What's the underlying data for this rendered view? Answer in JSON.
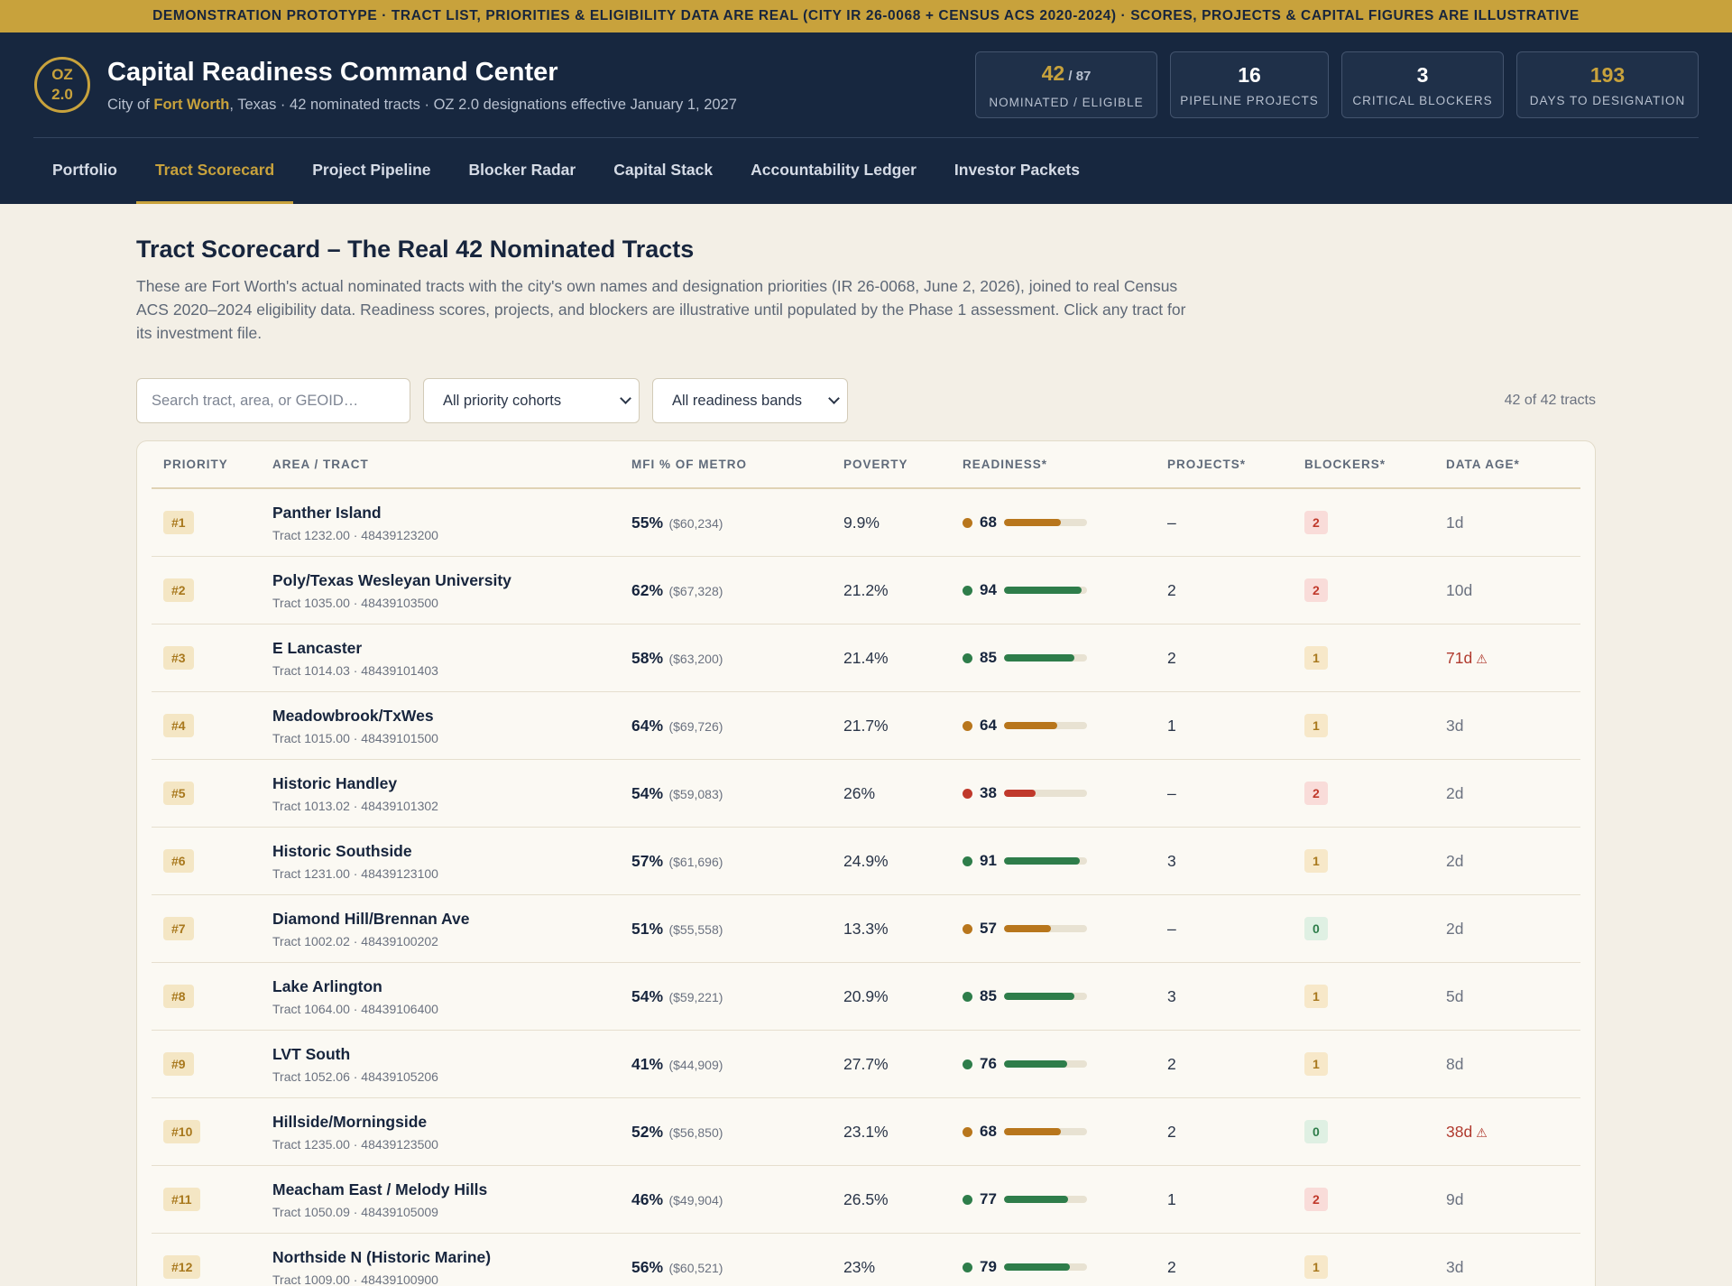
{
  "banner": "DEMONSTRATION PROTOTYPE · TRACT LIST, PRIORITIES & ELIGIBILITY DATA ARE REAL (CITY IR 26-0068 + CENSUS ACS 2020-2024) · SCORES, PROJECTS & CAPITAL FIGURES ARE ILLUSTRATIVE",
  "logo": {
    "line1": "OZ",
    "line2": "2.0"
  },
  "app": {
    "title": "Capital Readiness Command Center",
    "subtitle_pre": "City of ",
    "city": "Fort Worth",
    "subtitle_post": ", Texas · 42 nominated tracts · OZ 2.0 designations effective January 1, 2027"
  },
  "stats": [
    {
      "value": "42",
      "suffix": " / 87",
      "label": "NOMINATED / ELIGIBLE"
    },
    {
      "value": "16",
      "label": "PIPELINE PROJECTS"
    },
    {
      "value": "3",
      "label": "CRITICAL BLOCKERS"
    },
    {
      "value": "193",
      "label": "DAYS TO DESIGNATION"
    }
  ],
  "tabs": [
    "Portfolio",
    "Tract Scorecard",
    "Project Pipeline",
    "Blocker Radar",
    "Capital Stack",
    "Accountability Ledger",
    "Investor Packets"
  ],
  "page": {
    "title": "Tract Scorecard – The Real 42 Nominated Tracts",
    "description": "These are Fort Worth's actual nominated tracts with the city's own names and designation priorities (IR 26-0068, June 2, 2026), joined to real Census ACS 2020–2024 eligibility data. Readiness scores, projects, and blockers are illustrative until populated by the Phase 1 assessment. Click any tract for its investment file."
  },
  "filters": {
    "search_placeholder": "Search tract, area, or GEOID…",
    "cohort": "All priority cohorts",
    "band": "All readiness bands",
    "count": "42 of 42 tracts"
  },
  "columns": [
    "PRIORITY",
    "AREA / TRACT",
    "MFI % OF METRO",
    "POVERTY",
    "READINESS*",
    "PROJECTS*",
    "BLOCKERS*",
    "DATA AGE*"
  ],
  "colors": {
    "green": "#2e7d4a",
    "amber": "#b8761c",
    "red": "#c0392b",
    "gold": "#c8a23c",
    "navy": "#17273f"
  },
  "rows": [
    {
      "rank": "#1",
      "name": "Panther Island",
      "tract": "Tract 1232.00 · 48439123200",
      "mfi": "55%",
      "mfi_d": "($60,234)",
      "poverty": "9.9%",
      "readiness": 68,
      "band": "amber",
      "projects": "–",
      "blockers": "2",
      "blk": "r",
      "age": "1d",
      "warn": false
    },
    {
      "rank": "#2",
      "name": "Poly/Texas Wesleyan University",
      "tract": "Tract 1035.00 · 48439103500",
      "mfi": "62%",
      "mfi_d": "($67,328)",
      "poverty": "21.2%",
      "readiness": 94,
      "band": "green",
      "projects": "2",
      "blockers": "2",
      "blk": "r",
      "age": "10d",
      "warn": false
    },
    {
      "rank": "#3",
      "name": "E Lancaster",
      "tract": "Tract 1014.03 · 48439101403",
      "mfi": "58%",
      "mfi_d": "($63,200)",
      "poverty": "21.4%",
      "readiness": 85,
      "band": "green",
      "projects": "2",
      "blockers": "1",
      "blk": "a",
      "age": "71d",
      "warn": true
    },
    {
      "rank": "#4",
      "name": "Meadowbrook/TxWes",
      "tract": "Tract 1015.00 · 48439101500",
      "mfi": "64%",
      "mfi_d": "($69,726)",
      "poverty": "21.7%",
      "readiness": 64,
      "band": "amber",
      "projects": "1",
      "blockers": "1",
      "blk": "a",
      "age": "3d",
      "warn": false
    },
    {
      "rank": "#5",
      "name": "Historic Handley",
      "tract": "Tract 1013.02 · 48439101302",
      "mfi": "54%",
      "mfi_d": "($59,083)",
      "poverty": "26%",
      "readiness": 38,
      "band": "red",
      "projects": "–",
      "blockers": "2",
      "blk": "r",
      "age": "2d",
      "warn": false
    },
    {
      "rank": "#6",
      "name": "Historic Southside",
      "tract": "Tract 1231.00 · 48439123100",
      "mfi": "57%",
      "mfi_d": "($61,696)",
      "poverty": "24.9%",
      "readiness": 91,
      "band": "green",
      "projects": "3",
      "blockers": "1",
      "blk": "a",
      "age": "2d",
      "warn": false
    },
    {
      "rank": "#7",
      "name": "Diamond Hill/Brennan Ave",
      "tract": "Tract 1002.02 · 48439100202",
      "mfi": "51%",
      "mfi_d": "($55,558)",
      "poverty": "13.3%",
      "readiness": 57,
      "band": "amber",
      "projects": "–",
      "blockers": "0",
      "blk": "g",
      "age": "2d",
      "warn": false
    },
    {
      "rank": "#8",
      "name": "Lake Arlington",
      "tract": "Tract 1064.00 · 48439106400",
      "mfi": "54%",
      "mfi_d": "($59,221)",
      "poverty": "20.9%",
      "readiness": 85,
      "band": "green",
      "projects": "3",
      "blockers": "1",
      "blk": "a",
      "age": "5d",
      "warn": false
    },
    {
      "rank": "#9",
      "name": "LVT South",
      "tract": "Tract 1052.06 · 48439105206",
      "mfi": "41%",
      "mfi_d": "($44,909)",
      "poverty": "27.7%",
      "readiness": 76,
      "band": "green",
      "projects": "2",
      "blockers": "1",
      "blk": "a",
      "age": "8d",
      "warn": false
    },
    {
      "rank": "#10",
      "name": "Hillside/Morningside",
      "tract": "Tract 1235.00 · 48439123500",
      "mfi": "52%",
      "mfi_d": "($56,850)",
      "poverty": "23.1%",
      "readiness": 68,
      "band": "amber",
      "projects": "2",
      "blockers": "0",
      "blk": "g",
      "age": "38d",
      "warn": true
    },
    {
      "rank": "#11",
      "name": "Meacham East / Melody Hills",
      "tract": "Tract 1050.09 · 48439105009",
      "mfi": "46%",
      "mfi_d": "($49,904)",
      "poverty": "26.5%",
      "readiness": 77,
      "band": "green",
      "projects": "1",
      "blockers": "2",
      "blk": "r",
      "age": "9d",
      "warn": false
    },
    {
      "rank": "#12",
      "name": "Northside N (Historic Marine)",
      "tract": "Tract 1009.00 · 48439100900",
      "mfi": "56%",
      "mfi_d": "($60,521)",
      "poverty": "23%",
      "readiness": 79,
      "band": "green",
      "projects": "2",
      "blockers": "1",
      "blk": "a",
      "age": "3d",
      "warn": false
    }
  ]
}
